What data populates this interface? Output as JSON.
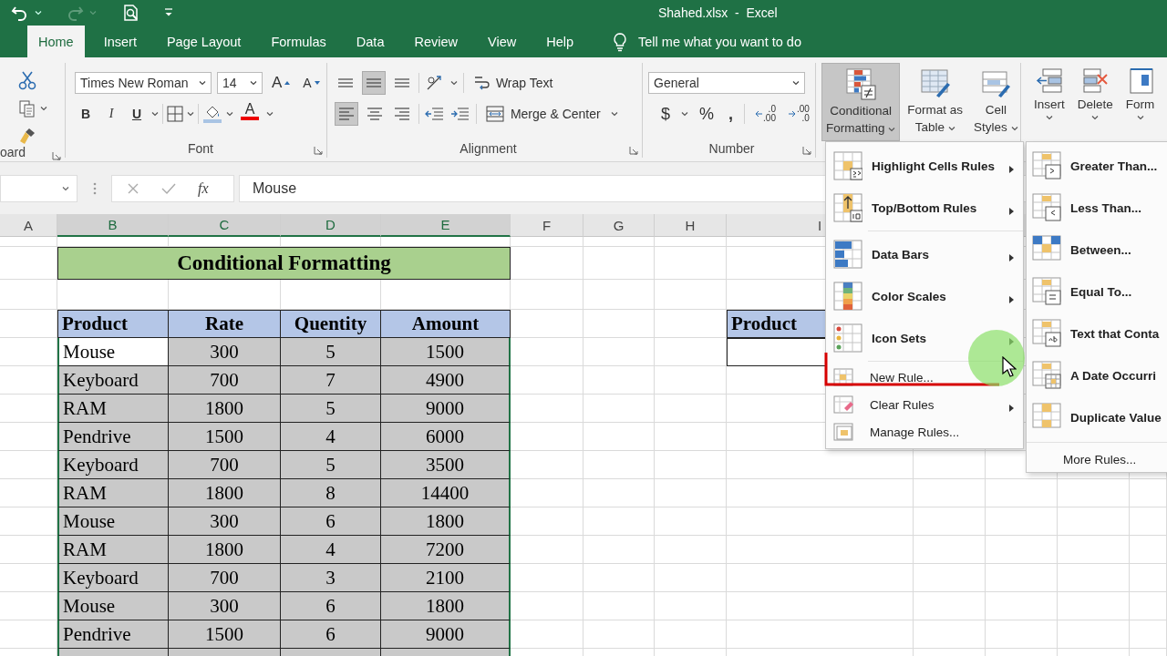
{
  "title_bar": {
    "title": "Shahed.xlsx  -  Excel",
    "redo_disabled": true
  },
  "tabs": [
    {
      "label": "Home",
      "selected": true
    },
    {
      "label": "Insert",
      "selected": false
    },
    {
      "label": "Page Layout",
      "selected": false
    },
    {
      "label": "Formulas",
      "selected": false
    },
    {
      "label": "Data",
      "selected": false
    },
    {
      "label": "Review",
      "selected": false
    },
    {
      "label": "View",
      "selected": false
    },
    {
      "label": "Help",
      "selected": false
    }
  ],
  "tell_me": {
    "placeholder": "Tell me what you want to do"
  },
  "ribbon": {
    "clipboard": {
      "label": "oard"
    },
    "font": {
      "label": "Font",
      "font_name": "Times New Roman",
      "font_size": "14",
      "grow": "A",
      "shrink": "A",
      "bold": "B",
      "italic": "I",
      "underline": "U",
      "font_color": "A"
    },
    "alignment": {
      "label": "Alignment",
      "align_buttons": [
        {
          "kind": "top",
          "selected": false
        },
        {
          "kind": "middle",
          "selected": true
        },
        {
          "kind": "bottom",
          "selected": false
        },
        {
          "kind": "left",
          "selected": true
        },
        {
          "kind": "center",
          "selected": false
        },
        {
          "kind": "right",
          "selected": false
        }
      ],
      "wrap_text": "Wrap Text",
      "merge": "Merge & Center"
    },
    "number": {
      "label": "Number",
      "format": "General",
      "currency": "$",
      "percent": "%",
      "comma": ",",
      "decimals": [
        {
          "top": ".0",
          "bottom": ".00"
        },
        {
          "top": ".00",
          "bottom": ".0"
        }
      ]
    },
    "styles": [
      {
        "lines": [
          "Conditional",
          "Formatting"
        ],
        "selected": true
      },
      {
        "lines": [
          "Format as",
          "Table"
        ],
        "selected": false
      },
      {
        "lines": [
          "Cell",
          "Styles"
        ],
        "selected": false
      }
    ],
    "cells": [
      {
        "label": "Insert"
      },
      {
        "label": "Delete"
      },
      {
        "label": "Form"
      }
    ]
  },
  "formula_bar": {
    "fx": "fx",
    "formula": "Mouse"
  },
  "sheet": {
    "columns": [
      {
        "letter": "A",
        "selected": false
      },
      {
        "letter": "B",
        "selected": true
      },
      {
        "letter": "C",
        "selected": true
      },
      {
        "letter": "D",
        "selected": true
      },
      {
        "letter": "E",
        "selected": true
      },
      {
        "letter": "F",
        "selected": false
      },
      {
        "letter": "G",
        "selected": false
      },
      {
        "letter": "H",
        "selected": false
      },
      {
        "letter": "I",
        "selected": false
      }
    ],
    "title": "Conditional Formatting",
    "table": {
      "columns": [
        "Product",
        "Rate",
        "Quentity",
        "Amount"
      ],
      "rows": [
        {
          "cells": [
            "Mouse",
            "300",
            "5",
            "1500"
          ],
          "selected": true,
          "active": true
        },
        {
          "cells": [
            "Keyboard",
            "700",
            "7",
            "4900"
          ],
          "selected": true,
          "active": false
        },
        {
          "cells": [
            "RAM",
            "1800",
            "5",
            "9000"
          ],
          "selected": true,
          "active": false
        },
        {
          "cells": [
            "Pendrive",
            "1500",
            "4",
            "6000"
          ],
          "selected": true,
          "active": false
        },
        {
          "cells": [
            "Keyboard",
            "700",
            "5",
            "3500"
          ],
          "selected": true,
          "active": false
        },
        {
          "cells": [
            "RAM",
            "1800",
            "8",
            "14400"
          ],
          "selected": true,
          "active": false
        },
        {
          "cells": [
            "Mouse",
            "300",
            "6",
            "1800"
          ],
          "selected": true,
          "active": false
        },
        {
          "cells": [
            "RAM",
            "1800",
            "4",
            "7200"
          ],
          "selected": true,
          "active": false
        },
        {
          "cells": [
            "Keyboard",
            "700",
            "3",
            "2100"
          ],
          "selected": true,
          "active": false
        },
        {
          "cells": [
            "Mouse",
            "300",
            "6",
            "1800"
          ],
          "selected": true,
          "active": false
        },
        {
          "cells": [
            "Pendrive",
            "1500",
            "6",
            "9000"
          ],
          "selected": true,
          "active": false
        }
      ]
    },
    "lookup": {
      "header": "Product"
    }
  },
  "menu": {
    "groups": [
      [
        {
          "label": "Highlight Cells Rules",
          "kind": "large",
          "submenu": true
        },
        {
          "label": "Top/Bottom Rules",
          "kind": "large",
          "submenu": true
        }
      ],
      [
        {
          "label": "Data Bars",
          "kind": "large",
          "submenu": true
        },
        {
          "label": "Color Scales",
          "kind": "large",
          "submenu": true
        },
        {
          "label": "Icon Sets",
          "kind": "large",
          "submenu": true
        }
      ],
      [
        {
          "label": "New Rule...",
          "kind": "small",
          "submenu": false
        },
        {
          "label": "Clear Rules",
          "kind": "small",
          "submenu": true
        },
        {
          "label": "Manage Rules...",
          "kind": "small",
          "submenu": false
        }
      ]
    ]
  },
  "submenu": {
    "items": [
      {
        "label": "Greater Than..."
      },
      {
        "label": "Less Than..."
      },
      {
        "label": "Between..."
      },
      {
        "label": "Equal To..."
      },
      {
        "label": "Text that Conta"
      },
      {
        "label": "A Date Occurri"
      },
      {
        "label": "Duplicate Value"
      }
    ],
    "more": "More Rules..."
  }
}
